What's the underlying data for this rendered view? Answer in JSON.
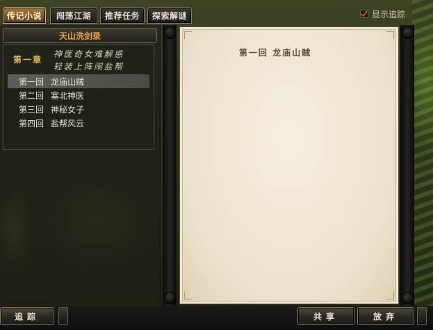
{
  "tabs": [
    {
      "label": "传记小说",
      "active": true
    },
    {
      "label": "闯荡江湖",
      "active": false
    },
    {
      "label": "推荐任务",
      "active": false
    },
    {
      "label": "探索解谜",
      "active": false
    }
  ],
  "show_track": {
    "label": "显示追踪",
    "checked": true
  },
  "book": {
    "title": "天山洗剑录",
    "chapter": {
      "label": "第一章",
      "name_lines": [
        "神医奇女难解惑",
        "轻装上阵闹盐帮"
      ]
    },
    "sections": [
      {
        "num": "第一回",
        "name": "龙庙山贼",
        "active": true
      },
      {
        "num": "第二回",
        "name": "塞北神医",
        "active": false
      },
      {
        "num": "第三回",
        "name": "神秘女子",
        "active": false
      },
      {
        "num": "第四回",
        "name": "盐帮风云",
        "active": false
      }
    ]
  },
  "page": {
    "title": "第一回  龙庙山贼"
  },
  "buttons": {
    "track": "追踪",
    "share": "共享",
    "abandon": "放弃"
  },
  "colors": {
    "accent": "#f0a338",
    "paper": "#efe7d5",
    "text_dark": "#5d4c32"
  }
}
